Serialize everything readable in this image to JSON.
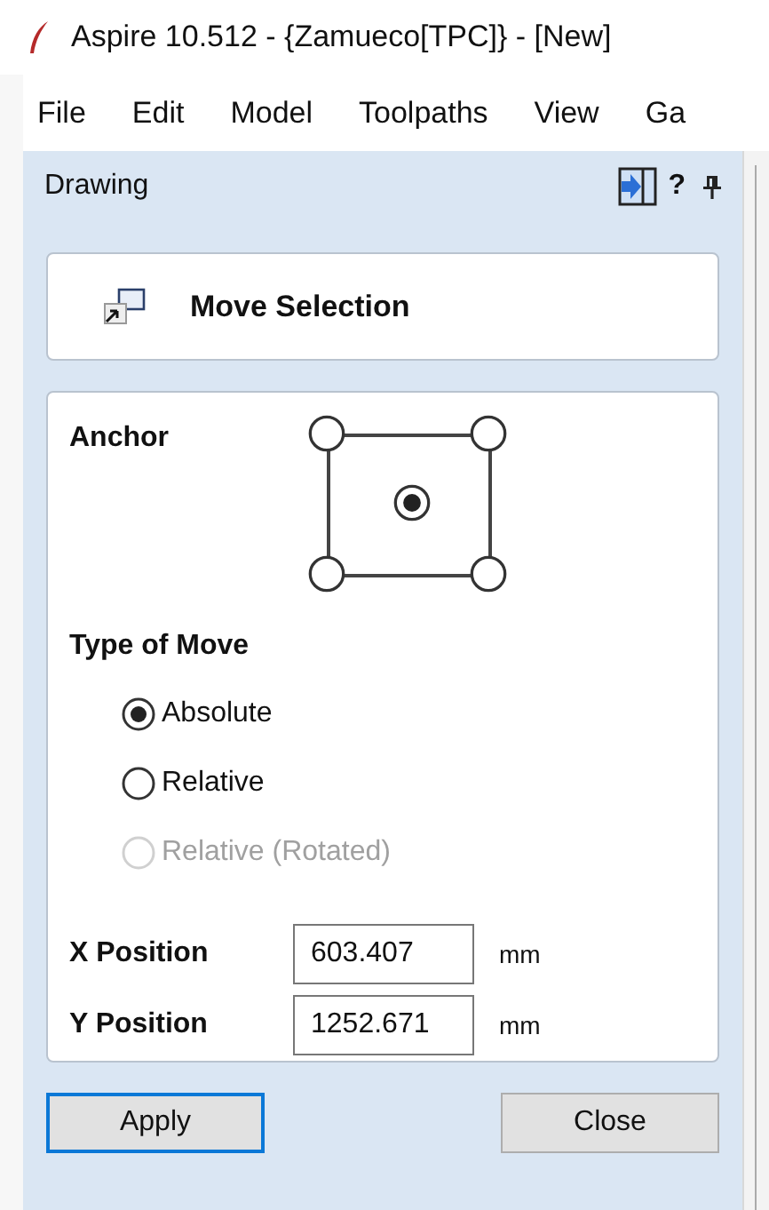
{
  "window": {
    "title": "Aspire 10.512 - {Zamueco[TPC]} - [New]"
  },
  "menu": [
    "File",
    "Edit",
    "Model",
    "Toolpaths",
    "View",
    "Ga"
  ],
  "panel": {
    "title": "Drawing",
    "help": "?"
  },
  "tool": {
    "title": "Move Selection"
  },
  "anchor": {
    "label": "Anchor",
    "points": [
      {
        "selected": false
      },
      {
        "selected": false
      },
      {
        "selected": true
      },
      {
        "selected": false
      },
      {
        "selected": false
      }
    ]
  },
  "move_type": {
    "label": "Type of Move",
    "options": [
      {
        "label": "Absolute",
        "selected": true,
        "disabled": false
      },
      {
        "label": "Relative",
        "selected": false,
        "disabled": false
      },
      {
        "label": "Relative (Rotated)",
        "selected": false,
        "disabled": true
      }
    ]
  },
  "fields": [
    {
      "label": "X Position",
      "value": "603.407",
      "unit": "mm"
    },
    {
      "label": "Y Position",
      "value": "1252.671",
      "unit": "mm"
    }
  ],
  "buttons": [
    {
      "label": "Apply",
      "focused": true
    },
    {
      "label": "Close",
      "focused": false
    }
  ]
}
